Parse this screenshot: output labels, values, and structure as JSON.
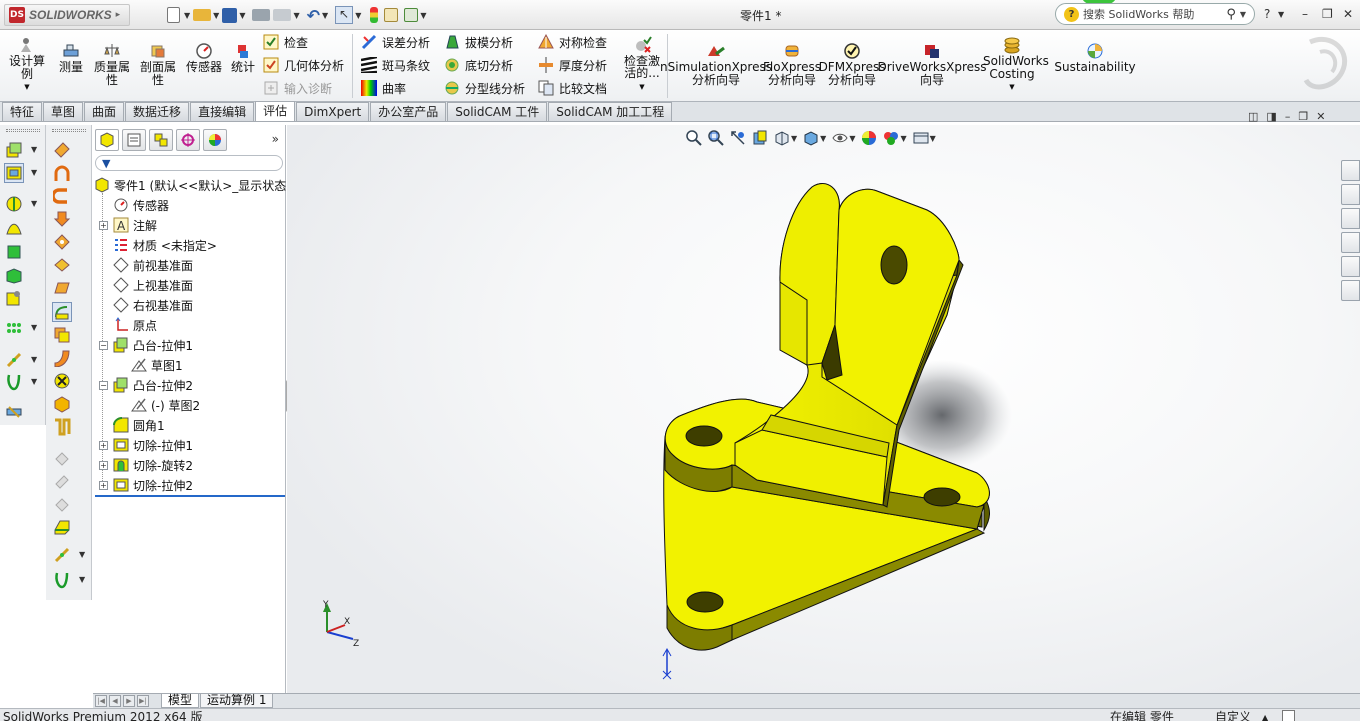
{
  "app": {
    "logo_text": "SOLIDWORKS",
    "document_title": "零件1 *",
    "search_placeholder": "搜索 SolidWorks 帮助",
    "help_symbol": "?"
  },
  "ribbon": {
    "design_study": "设计算例",
    "measure": "测量",
    "mass_props": "质量属性",
    "section_props": "剖面属性",
    "sensor": "传感器",
    "statistics": "统计",
    "check": "检查",
    "geometry_analysis": "几何体分析",
    "import_diagnostics": "输入诊断",
    "deviation_analysis": "误差分析",
    "zebra_stripes": "斑马条纹",
    "curvature": "曲率",
    "draft_analysis": "拔模分析",
    "undercut_analysis": "底切分析",
    "parting_line_analysis": "分型线分析",
    "symmetry_check": "对称检查",
    "thickness_analysis": "厚度分析",
    "compare_documents": "比较文档",
    "check_active": "检查激活的...",
    "simulation_xpress": "nSimulationXpress 分析向导",
    "floxpress": "FloXpress 分析向导",
    "dfmxpress": "DFMXpress 分析向导",
    "driveworksxpress": "DriveWorksXpress 向导",
    "costing": "SolidWorks Costing",
    "sustainability": "Sustainability"
  },
  "tabs": [
    "特征",
    "草图",
    "曲面",
    "数据迁移",
    "直接编辑",
    "评估",
    "DimXpert",
    "办公室产品",
    "SolidCAM 工件",
    "SolidCAM 加工工程"
  ],
  "active_tab": "评估",
  "tree": {
    "root": "零件1  (默认<<默认>_显示状态",
    "items": [
      "传感器",
      "注解",
      "材质 <未指定>",
      "前视基准面",
      "上视基准面",
      "右视基准面",
      "原点",
      "凸台-拉伸1",
      "草图1",
      "凸台-拉伸2",
      "(-) 草图2",
      "圆角1",
      "切除-拉伸1",
      "切除-旋转2",
      "切除-拉伸2"
    ]
  },
  "bottom_tabs": [
    "模型",
    "运动算例 1"
  ],
  "status": {
    "left": "SolidWorks Premium 2012 x64 版",
    "mode": "在编辑 零件",
    "units": "自定义"
  },
  "axis_labels": {
    "x": "X",
    "y": "Y",
    "z": "Z"
  },
  "colors": {
    "part_yellow": "#f2f200",
    "part_shadow": "#8f8f00",
    "selection_blue": "#2468c9"
  }
}
